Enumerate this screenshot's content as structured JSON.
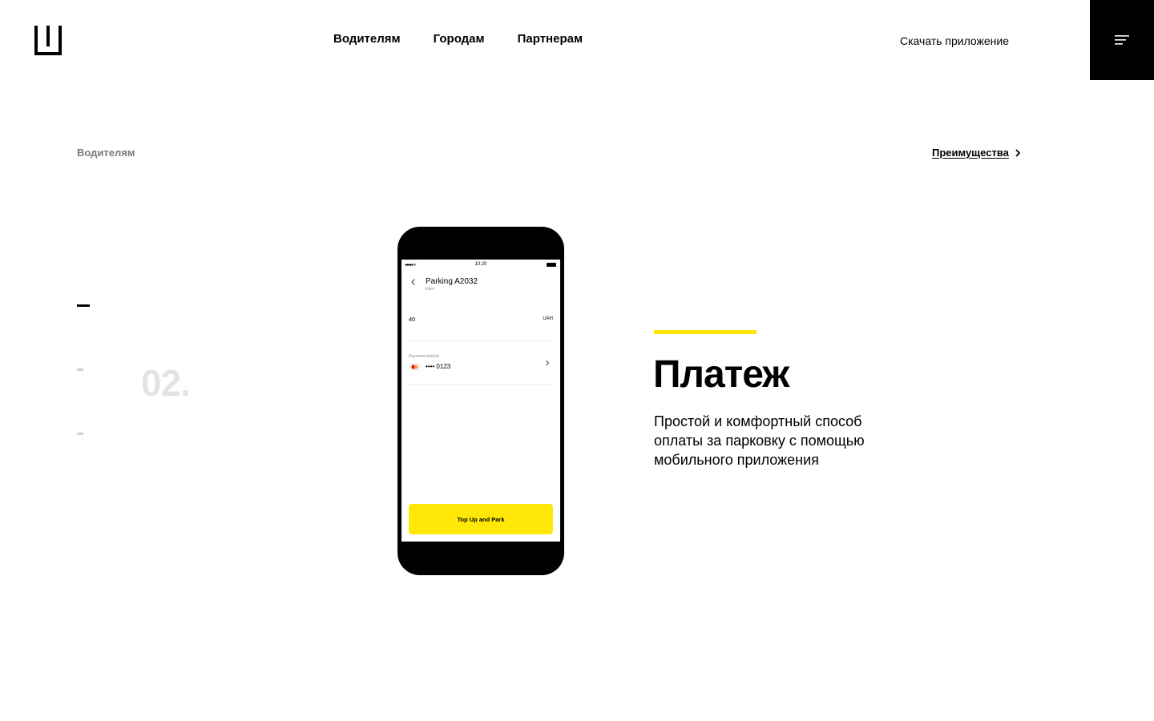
{
  "header": {
    "logo_name": "parking-bracket-logo",
    "nav": [
      {
        "label": "Водителям"
      },
      {
        "label": "Городам"
      },
      {
        "label": "Партнерам"
      }
    ],
    "download_label": "Скачать приложение",
    "menu_icon": "hamburger-menu-icon"
  },
  "breadcrumb": {
    "current": "Водителям"
  },
  "advantages_link": {
    "label": "Преимущества",
    "icon": "chevron-right-icon"
  },
  "slider": {
    "current_number": "02.",
    "indicator_count": 3,
    "active_index": 0
  },
  "phone_screen": {
    "status_time": "10:20",
    "status_signal": "●●●●● ᯤ",
    "title": "Parking A2032",
    "subtitle": "Kiev",
    "amount": "40",
    "currency": "UAH",
    "payment_method_label": "Payment method",
    "card_number": "•••• 0123",
    "button_label": "Top Up and Park"
  },
  "content": {
    "heading": "Платеж",
    "description": "Простой и комфортный способ оплаты за парковку с помощью мобильного приложения"
  },
  "colors": {
    "accent_yellow": "#ffe708",
    "black": "#000000",
    "muted_gray": "#7a7a7a",
    "number_gray": "#e3e3e3"
  }
}
